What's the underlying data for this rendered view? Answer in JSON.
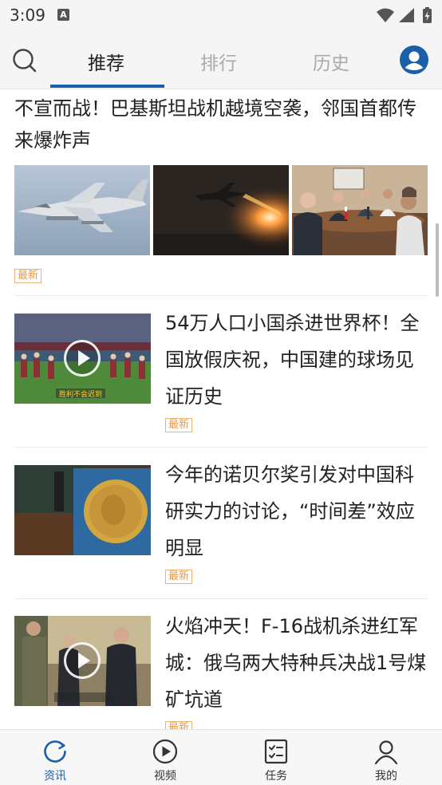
{
  "status_bar": {
    "time": "3:09",
    "notification_icon": "A",
    "icons": [
      "wifi-icon",
      "signal-icon",
      "battery-charging-icon"
    ]
  },
  "header": {
    "search_icon": "search-icon",
    "tabs": [
      {
        "label": "推荐",
        "active": true
      },
      {
        "label": "排行",
        "active": false
      },
      {
        "label": "历史",
        "active": false
      }
    ],
    "user_icon": "user-avatar-icon"
  },
  "feed": {
    "articles": [
      {
        "title": "不宣而战！巴基斯坦战机越境空袭，邻国首都传来爆炸声",
        "tag": "最新",
        "images": [
          "fighter-jet-photo",
          "night-jet-launch-photo",
          "diplomatic-meeting-photo"
        ]
      },
      {
        "title": "54万人口小国杀进世界杯！全国放假庆祝，中国建的球场见证历史",
        "tag": "最新",
        "is_video": true,
        "image": "football-team-stadium-photo",
        "image_caption": "胜利不会迟到"
      },
      {
        "title": "今年的诺贝尔奖引发对中国科研实力的讨论，“时间差”效应明显",
        "tag": "最新",
        "is_video": false,
        "image": "nobel-medal-photo"
      },
      {
        "title": "火焰冲天！F-16战机杀进红军城：俄乌两大特种兵决战1号煤矿坑道",
        "tag": "最新",
        "is_video": true,
        "image": "military-officers-photo"
      }
    ]
  },
  "bottom_nav": {
    "items": [
      {
        "label": "资讯",
        "icon": "refresh-news-icon",
        "active": true
      },
      {
        "label": "视频",
        "icon": "play-circle-icon",
        "active": false
      },
      {
        "label": "任务",
        "icon": "task-list-icon",
        "active": false
      },
      {
        "label": "我的",
        "icon": "profile-icon",
        "active": false
      }
    ]
  },
  "colors": {
    "accent": "#1a5fa8",
    "tag": "#e39a4a",
    "inactive_tab": "#aaaaaa"
  }
}
